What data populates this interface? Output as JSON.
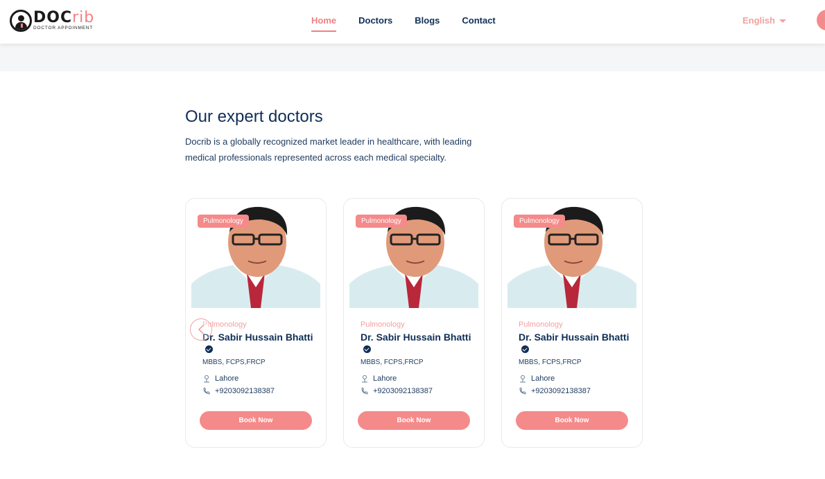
{
  "brand": {
    "name_dark": "DOC",
    "name_pink": "rib",
    "tagline": "DOCTOR APPOINMENT"
  },
  "nav": {
    "items": [
      {
        "label": "Home",
        "active": true
      },
      {
        "label": "Doctors",
        "active": false
      },
      {
        "label": "Blogs",
        "active": false
      },
      {
        "label": "Contact",
        "active": false
      }
    ],
    "language": "English"
  },
  "section": {
    "title": "Our expert doctors",
    "description": "Docrib is a globally recognized market leader in healthcare, with leading medical professionals represented across each medical specialty."
  },
  "doctors": [
    {
      "badge": "Pulmonology",
      "specialty": "Pulmonology",
      "name": "Dr. Sabir Hussain Bhatti",
      "qualifications": "MBBS, FCPS,FRCP",
      "location": "Lahore",
      "phone": "+9203092138387",
      "button": "Book Now"
    },
    {
      "badge": "Pulmonology",
      "specialty": "Pulmonology",
      "name": "Dr. Sabir Hussain Bhatti",
      "qualifications": "MBBS, FCPS,FRCP",
      "location": "Lahore",
      "phone": "+9203092138387",
      "button": "Book Now"
    },
    {
      "badge": "Pulmonology",
      "specialty": "Pulmonology",
      "name": "Dr. Sabir Hussain Bhatti",
      "qualifications": "MBBS, FCPS,FRCP",
      "location": "Lahore",
      "phone": "+9203092138387",
      "button": "Book Now"
    }
  ],
  "colors": {
    "accent": "#f58a8a",
    "navy": "#0f2e56"
  }
}
